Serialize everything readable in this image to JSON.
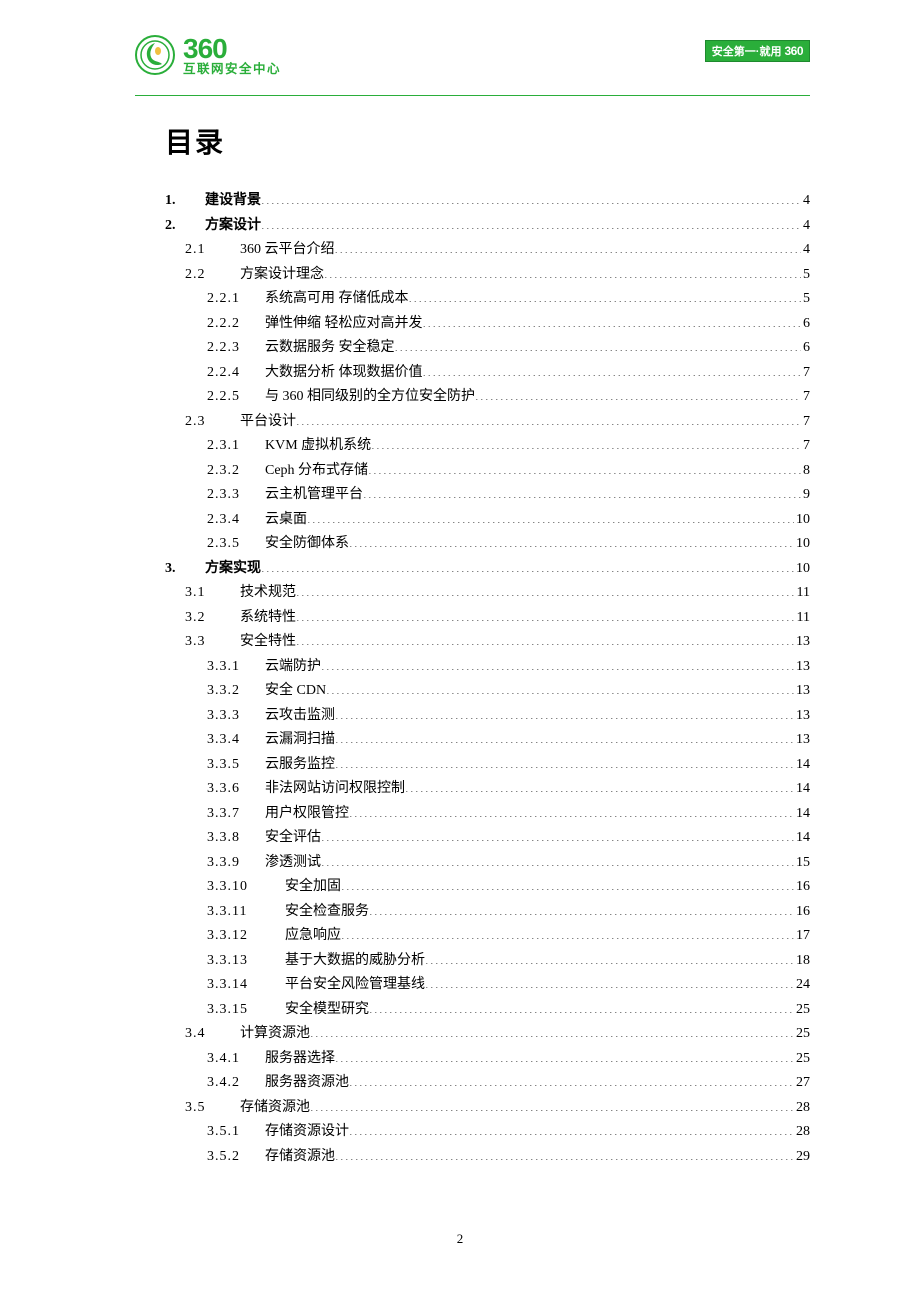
{
  "header": {
    "brand_number": "360",
    "brand_sub": "互联网安全中心",
    "badge_prefix": "安全第一·就用",
    "badge_brand": "360"
  },
  "title": "目录",
  "page_number": "2",
  "toc": [
    {
      "lvl": "1",
      "num": "1.",
      "label": "建设背景",
      "page": "4"
    },
    {
      "lvl": "1",
      "num": "2.",
      "label": "方案设计",
      "page": "4"
    },
    {
      "lvl": "2",
      "num": "2.1",
      "label": "360 云平台介绍",
      "page": "4"
    },
    {
      "lvl": "2b",
      "num": "2.2",
      "label": "方案设计理念",
      "page": "5"
    },
    {
      "lvl": "3",
      "num": "2.2.1",
      "label": "系统高可用 存储低成本",
      "page": "5"
    },
    {
      "lvl": "3",
      "num": "2.2.2",
      "label": "弹性伸缩 轻松应对高并发",
      "page": "6"
    },
    {
      "lvl": "3",
      "num": "2.2.3",
      "label": "云数据服务 安全稳定",
      "page": "6"
    },
    {
      "lvl": "3",
      "num": "2.2.4",
      "label": "大数据分析 体现数据价值",
      "page": "7"
    },
    {
      "lvl": "3",
      "num": "2.2.5",
      "label": "与 360 相同级别的全方位安全防护",
      "page": "7"
    },
    {
      "lvl": "2b",
      "num": "2.3",
      "label": "平台设计",
      "page": "7"
    },
    {
      "lvl": "3",
      "num": "2.3.1",
      "label": "KVM 虚拟机系统",
      "page": "7"
    },
    {
      "lvl": "3",
      "num": "2.3.2",
      "label": "Ceph 分布式存储",
      "page": "8"
    },
    {
      "lvl": "3",
      "num": "2.3.3",
      "label": "云主机管理平台",
      "page": "9"
    },
    {
      "lvl": "3",
      "num": "2.3.4",
      "label": "云桌面",
      "page": "10"
    },
    {
      "lvl": "3",
      "num": "2.3.5",
      "label": "安全防御体系",
      "page": "10"
    },
    {
      "lvl": "1",
      "num": "3.",
      "label": "方案实现",
      "page": "10"
    },
    {
      "lvl": "2b",
      "num": "3.1",
      "label": "技术规范",
      "page": "11"
    },
    {
      "lvl": "2b",
      "num": "3.2",
      "label": "系统特性",
      "page": "11"
    },
    {
      "lvl": "2b",
      "num": "3.3",
      "label": "安全特性",
      "page": "13"
    },
    {
      "lvl": "3",
      "num": "3.3.1",
      "label": "云端防护",
      "page": "13"
    },
    {
      "lvl": "3",
      "num": "3.3.2",
      "label": "安全 CDN",
      "page": "13"
    },
    {
      "lvl": "3",
      "num": "3.3.3",
      "label": "云攻击监测",
      "page": "13"
    },
    {
      "lvl": "3",
      "num": "3.3.4",
      "label": "云漏洞扫描",
      "page": "13"
    },
    {
      "lvl": "3",
      "num": "3.3.5",
      "label": "云服务监控",
      "page": "14"
    },
    {
      "lvl": "3",
      "num": "3.3.6",
      "label": "非法网站访问权限控制",
      "page": "14"
    },
    {
      "lvl": "3",
      "num": "3.3.7",
      "label": "用户权限管控",
      "page": "14"
    },
    {
      "lvl": "3",
      "num": "3.3.8",
      "label": "安全评估",
      "page": "14"
    },
    {
      "lvl": "3",
      "num": "3.3.9",
      "label": "渗透测试",
      "page": "15"
    },
    {
      "lvl": "3b",
      "num": "3.3.10",
      "label": "安全加固",
      "page": "16"
    },
    {
      "lvl": "3b",
      "num": "3.3.11",
      "label": "安全检查服务",
      "page": "16"
    },
    {
      "lvl": "3b",
      "num": "3.3.12",
      "label": "应急响应",
      "page": "17"
    },
    {
      "lvl": "3b",
      "num": "3.3.13",
      "label": "基于大数据的威胁分析",
      "page": "18"
    },
    {
      "lvl": "3b",
      "num": "3.3.14",
      "label": "平台安全风险管理基线",
      "page": "24"
    },
    {
      "lvl": "3b",
      "num": "3.3.15",
      "label": "安全模型研究",
      "page": "25"
    },
    {
      "lvl": "2b",
      "num": "3.4",
      "label": "计算资源池",
      "page": "25"
    },
    {
      "lvl": "3",
      "num": "3.4.1",
      "label": "服务器选择",
      "page": "25"
    },
    {
      "lvl": "3",
      "num": "3.4.2",
      "label": "服务器资源池",
      "page": "27"
    },
    {
      "lvl": "2b",
      "num": "3.5",
      "label": "存储资源池",
      "page": "28"
    },
    {
      "lvl": "3",
      "num": "3.5.1",
      "label": "存储资源设计",
      "page": "28"
    },
    {
      "lvl": "3",
      "num": "3.5.2",
      "label": "存储资源池",
      "page": "29"
    }
  ]
}
